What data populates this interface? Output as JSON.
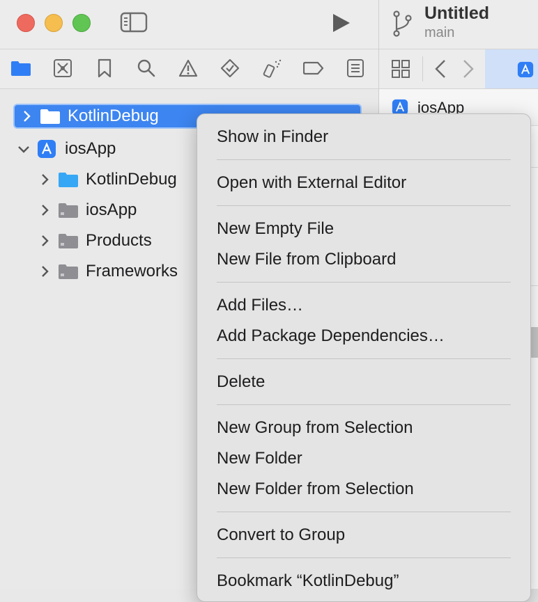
{
  "window": {
    "project_title": "Untitled",
    "branch": "main"
  },
  "navigator": {
    "tabs": [
      "folder-icon",
      "source-control-icon",
      "bookmark-icon",
      "search-icon",
      "warning-icon",
      "test-icon",
      "debug-icon",
      "breakpoint-icon",
      "report-icon"
    ],
    "items": [
      {
        "label": "KotlinDebug",
        "icon": "folder-icon",
        "selected": true,
        "expanded": false
      },
      {
        "label": "iosApp",
        "icon": "app-project-icon",
        "expanded": true
      },
      {
        "label": "KotlinDebug",
        "icon": "folder-icon"
      },
      {
        "label": "iosApp",
        "icon": "folder-icon"
      },
      {
        "label": "Products",
        "icon": "folder-icon"
      },
      {
        "label": "Frameworks",
        "icon": "folder-icon"
      }
    ]
  },
  "editor": {
    "jump_bar_item": "iosApp"
  },
  "context_menu": {
    "items": [
      "Show in Finder",
      "Open with External Editor",
      "New Empty File",
      "New File from Clipboard",
      "Add Files…",
      "Add Package Dependencies…",
      "Delete",
      "New Group from Selection",
      "New Folder",
      "New Folder from Selection",
      "Convert to Group",
      "Bookmark “KotlinDebug”"
    ]
  },
  "colors": {
    "accent": "#3d85f0",
    "folder_blue": "#36a7f5",
    "folder_gray": "#8e8e93"
  }
}
